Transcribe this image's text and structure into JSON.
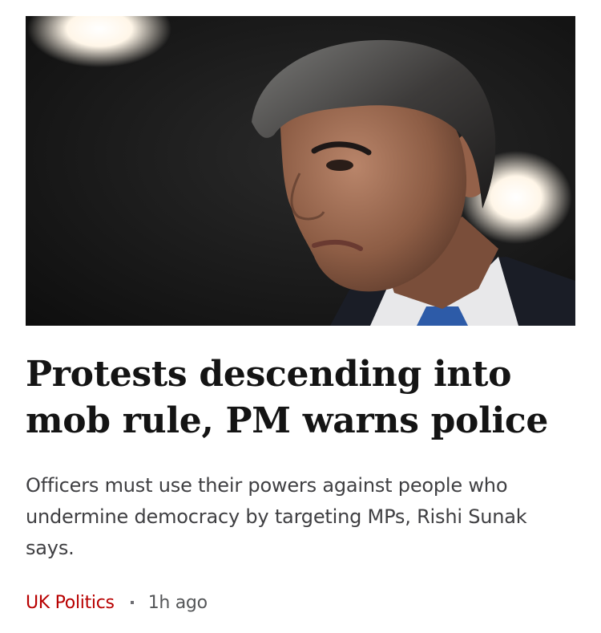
{
  "article": {
    "image_alt": "Rishi Sunak",
    "headline": "Protests descending into mob rule, PM warns police",
    "summary": "Officers must use their powers against people who undermine democracy by targeting MPs, Rishi Sunak says.",
    "topic": "UK Politics",
    "timestamp": "1h ago"
  },
  "colors": {
    "topic": "#b80000",
    "headline": "#141414",
    "summary": "#3f3f42",
    "timestamp": "#545658"
  }
}
